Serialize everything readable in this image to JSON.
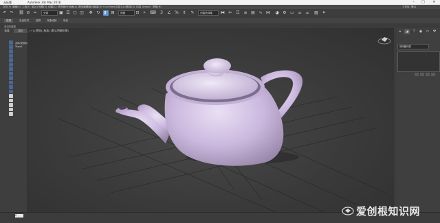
{
  "window": {
    "doc_name": "无标题",
    "app_title": "Autodesk 3ds Max 2018",
    "min": "–",
    "max": "□",
    "close": "✕"
  },
  "menu": {
    "items": [
      "文件(F)",
      "编辑(E)",
      "工具(T)",
      "组(G)",
      "视图(V)",
      "创建(C)",
      "修改器(M)",
      "动画(A)",
      "图形编辑器(D)",
      "渲染(R)",
      "Civil View",
      "自定义(U)",
      "脚本(S)",
      "内容",
      "Arnold",
      "帮助(H)"
    ],
    "workspace": "工作区: 默认"
  },
  "toolbar": {
    "selection_filter": "全部",
    "ref_coord": "视图",
    "named_selection": "创建选择集",
    "icons": [
      "undo-icon",
      "redo-icon",
      "link-icon",
      "unlink-icon",
      "bind-spacewarp-icon",
      "select-icon",
      "select-by-name-icon",
      "rect-select-icon",
      "window-crossing-icon",
      "move-icon",
      "rotate-icon",
      "scale-icon",
      "select-manipulate-icon",
      "pivot-icon",
      "keyboard-shortcut-icon",
      "snap-3d-icon",
      "angle-snap-icon",
      "percent-snap-icon",
      "spinner-snap-icon",
      "mirror-icon",
      "align-icon",
      "scene-explorer-icon",
      "layer-icon",
      "ribbon-icon",
      "curve-editor-icon",
      "schematic-icon",
      "material-editor-icon",
      "render-setup-icon",
      "render-frame-icon",
      "render-icon"
    ]
  },
  "subbar": {
    "items": [
      "建模",
      "自由形式",
      "选择",
      "对象绘制",
      "填充"
    ]
  },
  "ribbon": {
    "label": "多边形建模"
  },
  "left_panel": {
    "tab_select": "选择",
    "tab_display": "显示",
    "label1": "名称(按排序)",
    "label2": "Teapot"
  },
  "viewport": {
    "label": "[+] [透视] [标准] [默认明暗处理]",
    "object": "Teapot001",
    "teapot_color": "#c9b6dc"
  },
  "right_panel": {
    "icons": [
      "plus-icon",
      "modify-icon",
      "hierarchy-icon",
      "motion-icon",
      "display-icon",
      "utilities-icon"
    ],
    "modifier_list": "修改器列表"
  },
  "status": {
    "frame": "0"
  },
  "watermark": {
    "text": "爱创根知识网"
  }
}
